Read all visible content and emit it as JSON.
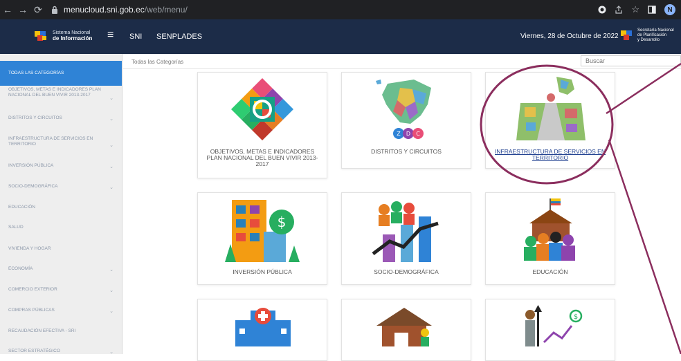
{
  "browser": {
    "url_host": "menucloud.sni.gob.ec",
    "url_path": "/web/menu/",
    "profile_initial": "N"
  },
  "header": {
    "logo_line1": "Sistema Nacional",
    "logo_line2": "de Información",
    "menu_items": [
      "SNI",
      "SENPLADES"
    ],
    "date": "Viernes, 28 de Octubre de 2022",
    "right_logo_line1": "Secretaría Nacional",
    "right_logo_line2": "de Planificación",
    "right_logo_line3": "y Desarrollo"
  },
  "breadcrumb": "Todas las Categorías",
  "search_placeholder": "Buscar",
  "sidebar": {
    "items": [
      {
        "label": "TODAS LAS CATEGORÍAS",
        "active": true
      },
      {
        "label": "OBJETIVOS, METAS E INDICADORES PLAN NACIONAL DEL BUEN VIVIR 2013-2017"
      },
      {
        "label": "DISTRITOS Y CIRCUITOS"
      },
      {
        "label": "INFRAESTRUCTURA DE SERVICIOS EN TERRITORIO"
      },
      {
        "label": "INVERSIÓN PÚBLICA"
      },
      {
        "label": "SOCIO-DEMOGRÁFICA"
      },
      {
        "label": "EDUCACIÓN"
      },
      {
        "label": "SALUD"
      },
      {
        "label": "VIVIENDA Y HOGAR"
      },
      {
        "label": "ECONOMÍA"
      },
      {
        "label": "COMERCIO EXTERIOR"
      },
      {
        "label": "COMPRAS PÚBLICAS"
      },
      {
        "label": "RECAUDACIÓN EFECTIVA - SRI"
      },
      {
        "label": "SECTOR ESTRATÉGICO"
      }
    ]
  },
  "cards": [
    {
      "label": "OBJETIVOS, METAS E INDICADORES PLAN NACIONAL DEL BUEN VIVIR 2013-2017"
    },
    {
      "label": "DISTRITOS Y CIRCUITOS"
    },
    {
      "label": "INFRAESTRUCTURA DE SERVICIOS EN TERRITORIO"
    },
    {
      "label": "INVERSIÓN PÚBLICA"
    },
    {
      "label": "SOCIO-DEMOGRÁFICA"
    },
    {
      "label": "EDUCACIÓN"
    },
    {
      "label": ""
    },
    {
      "label": ""
    },
    {
      "label": ""
    }
  ],
  "colors": {
    "header_bg": "#1c2c48",
    "sidebar_active": "#2f83d6",
    "annotation": "#8b2e5e"
  }
}
